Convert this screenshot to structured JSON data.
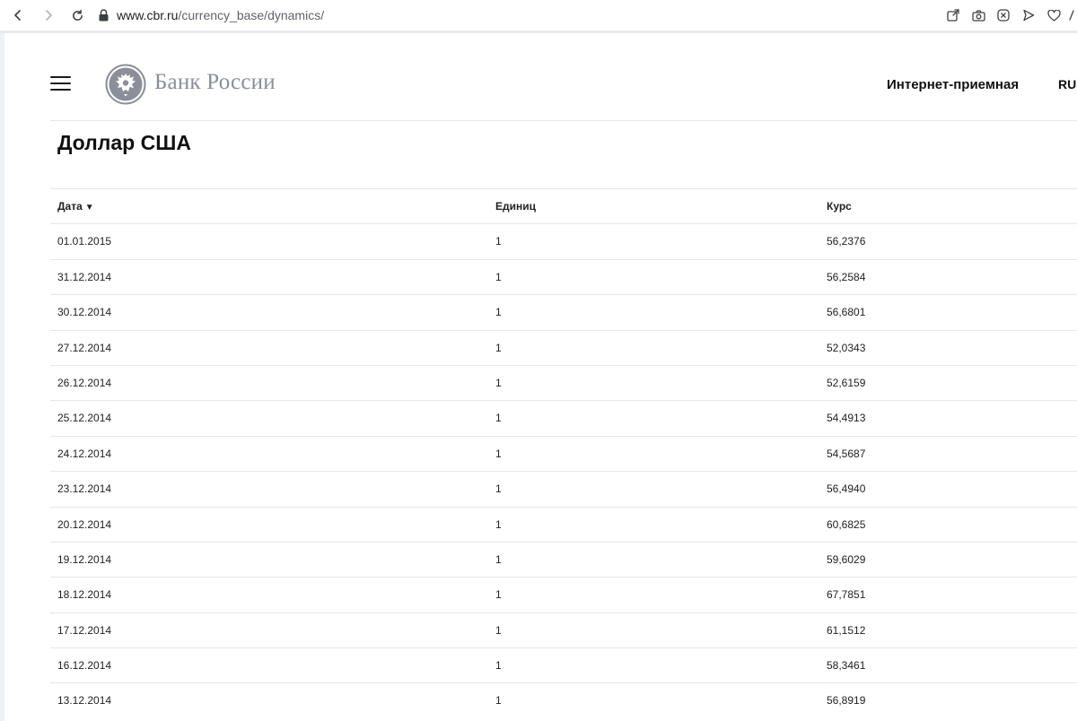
{
  "browser": {
    "url_host": "www.cbr.ru",
    "url_path": "/currency_base/dynamics/"
  },
  "header": {
    "logo_text": "Банк России",
    "reception_link": "Интернет-приемная",
    "language": "RU"
  },
  "page": {
    "title": "Доллар США"
  },
  "table": {
    "columns": {
      "date": "Дата",
      "date_sort_indicator": "▼",
      "units": "Единиц",
      "rate": "Курс"
    },
    "rows": [
      {
        "date": "01.01.2015",
        "units": "1",
        "rate": "56,2376"
      },
      {
        "date": "31.12.2014",
        "units": "1",
        "rate": "56,2584"
      },
      {
        "date": "30.12.2014",
        "units": "1",
        "rate": "56,6801"
      },
      {
        "date": "27.12.2014",
        "units": "1",
        "rate": "52,0343"
      },
      {
        "date": "26.12.2014",
        "units": "1",
        "rate": "52,6159"
      },
      {
        "date": "25.12.2014",
        "units": "1",
        "rate": "54,4913"
      },
      {
        "date": "24.12.2014",
        "units": "1",
        "rate": "54,5687"
      },
      {
        "date": "23.12.2014",
        "units": "1",
        "rate": "56,4940"
      },
      {
        "date": "20.12.2014",
        "units": "1",
        "rate": "60,6825"
      },
      {
        "date": "19.12.2014",
        "units": "1",
        "rate": "59,6029"
      },
      {
        "date": "18.12.2014",
        "units": "1",
        "rate": "67,7851"
      },
      {
        "date": "17.12.2014",
        "units": "1",
        "rate": "61,1512"
      },
      {
        "date": "16.12.2014",
        "units": "1",
        "rate": "58,3461"
      },
      {
        "date": "13.12.2014",
        "units": "1",
        "rate": "56,8919"
      }
    ]
  },
  "icons": {
    "back": "chevron-left-icon",
    "forward": "chevron-right-icon",
    "reload": "reload-icon",
    "lock": "lock-icon",
    "share": "share-icon",
    "screenshot": "camera-icon",
    "close_tab": "close-circle-icon",
    "send": "send-icon",
    "favorite": "heart-icon",
    "menu": "hamburger-menu-icon",
    "emblem": "bank-emblem-icon"
  }
}
